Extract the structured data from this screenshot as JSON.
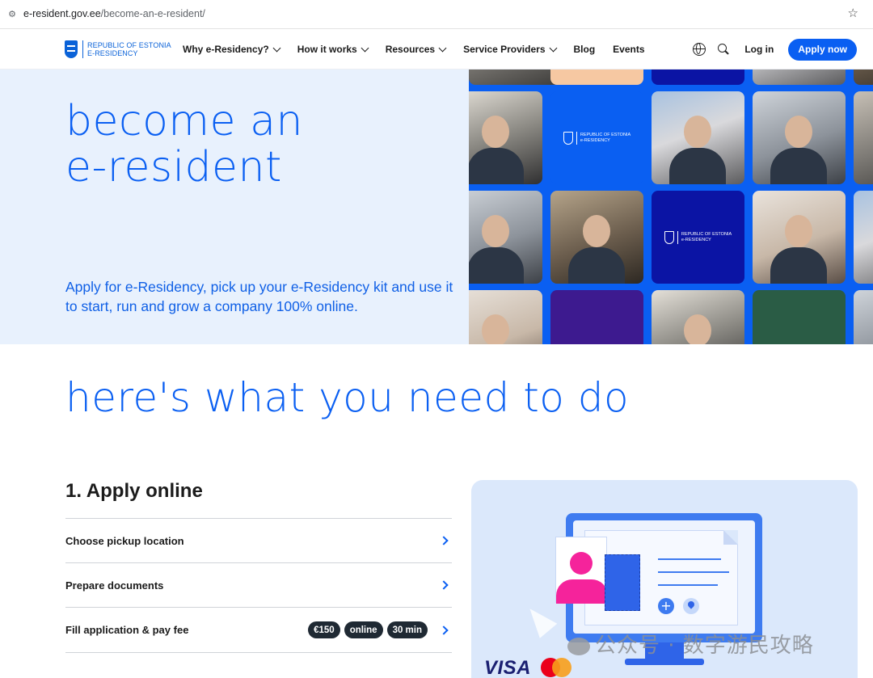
{
  "browser": {
    "url_domain": "e-resident.gov.ee",
    "url_path": "/become-an-e-resident/"
  },
  "header": {
    "logo_line1": "REPUBLIC OF ESTONIA",
    "logo_line2": "E-RESIDENCY",
    "nav": [
      {
        "label": "Why e-Residency?",
        "has_dropdown": true
      },
      {
        "label": "How it works",
        "has_dropdown": true
      },
      {
        "label": "Resources",
        "has_dropdown": true
      },
      {
        "label": "Service Providers",
        "has_dropdown": true
      },
      {
        "label": "Blog",
        "has_dropdown": false
      },
      {
        "label": "Events",
        "has_dropdown": false
      }
    ],
    "login_label": "Log in",
    "apply_label": "Apply now"
  },
  "hero": {
    "title_line1": "become an",
    "title_line2": "e-resident",
    "subtitle": "Apply for e-Residency, pick up your e-Residency kit and use it to start, run and grow a company 100% online.",
    "brand_tile_line1": "REPUBLIC OF ESTONIA",
    "brand_tile_line2": "e-RESIDENCY"
  },
  "section": {
    "title": "here's what you need to do"
  },
  "step": {
    "heading": "1. Apply online",
    "items": [
      {
        "label": "Choose pickup location"
      },
      {
        "label": "Prepare documents"
      },
      {
        "label": "Fill application & pay fee",
        "chips": [
          "€150",
          "online",
          "30 min"
        ]
      }
    ]
  },
  "illustration": {
    "card_brand": "VISA"
  },
  "watermark": "公众号 · 数字游民攻略",
  "colors": {
    "accent": "#0a5ff2",
    "hero_bg": "#e8f1fd",
    "chip_bg": "#1f2933",
    "illus_bg": "#dbe8fb"
  }
}
